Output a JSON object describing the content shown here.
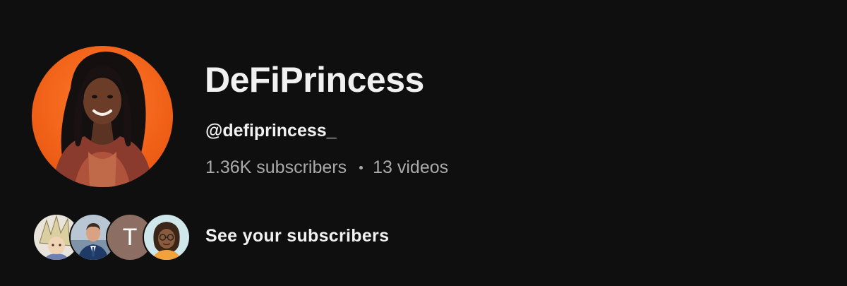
{
  "channel": {
    "name": "DeFiPrincess",
    "handle": "@defiprincess_",
    "subscribers": "1.36K subscribers",
    "separator": "•",
    "videos": "13 videos",
    "avatar_icon": "channel-avatar-photo",
    "avatar_bg_color": "#f26522"
  },
  "subscriber_preview": {
    "label": "See your subscribers",
    "avatars": [
      {
        "kind": "image",
        "icon": "anime-character-avatar"
      },
      {
        "kind": "image",
        "icon": "man-in-suit-avatar"
      },
      {
        "kind": "letter",
        "letter": "T",
        "color": "#8d6e63"
      },
      {
        "kind": "image",
        "icon": "cartoon-woman-avatar"
      }
    ]
  },
  "theme": {
    "background": "#0f0f0f",
    "primary_text": "#f1f1f1",
    "secondary_text": "#aaaaaa"
  }
}
